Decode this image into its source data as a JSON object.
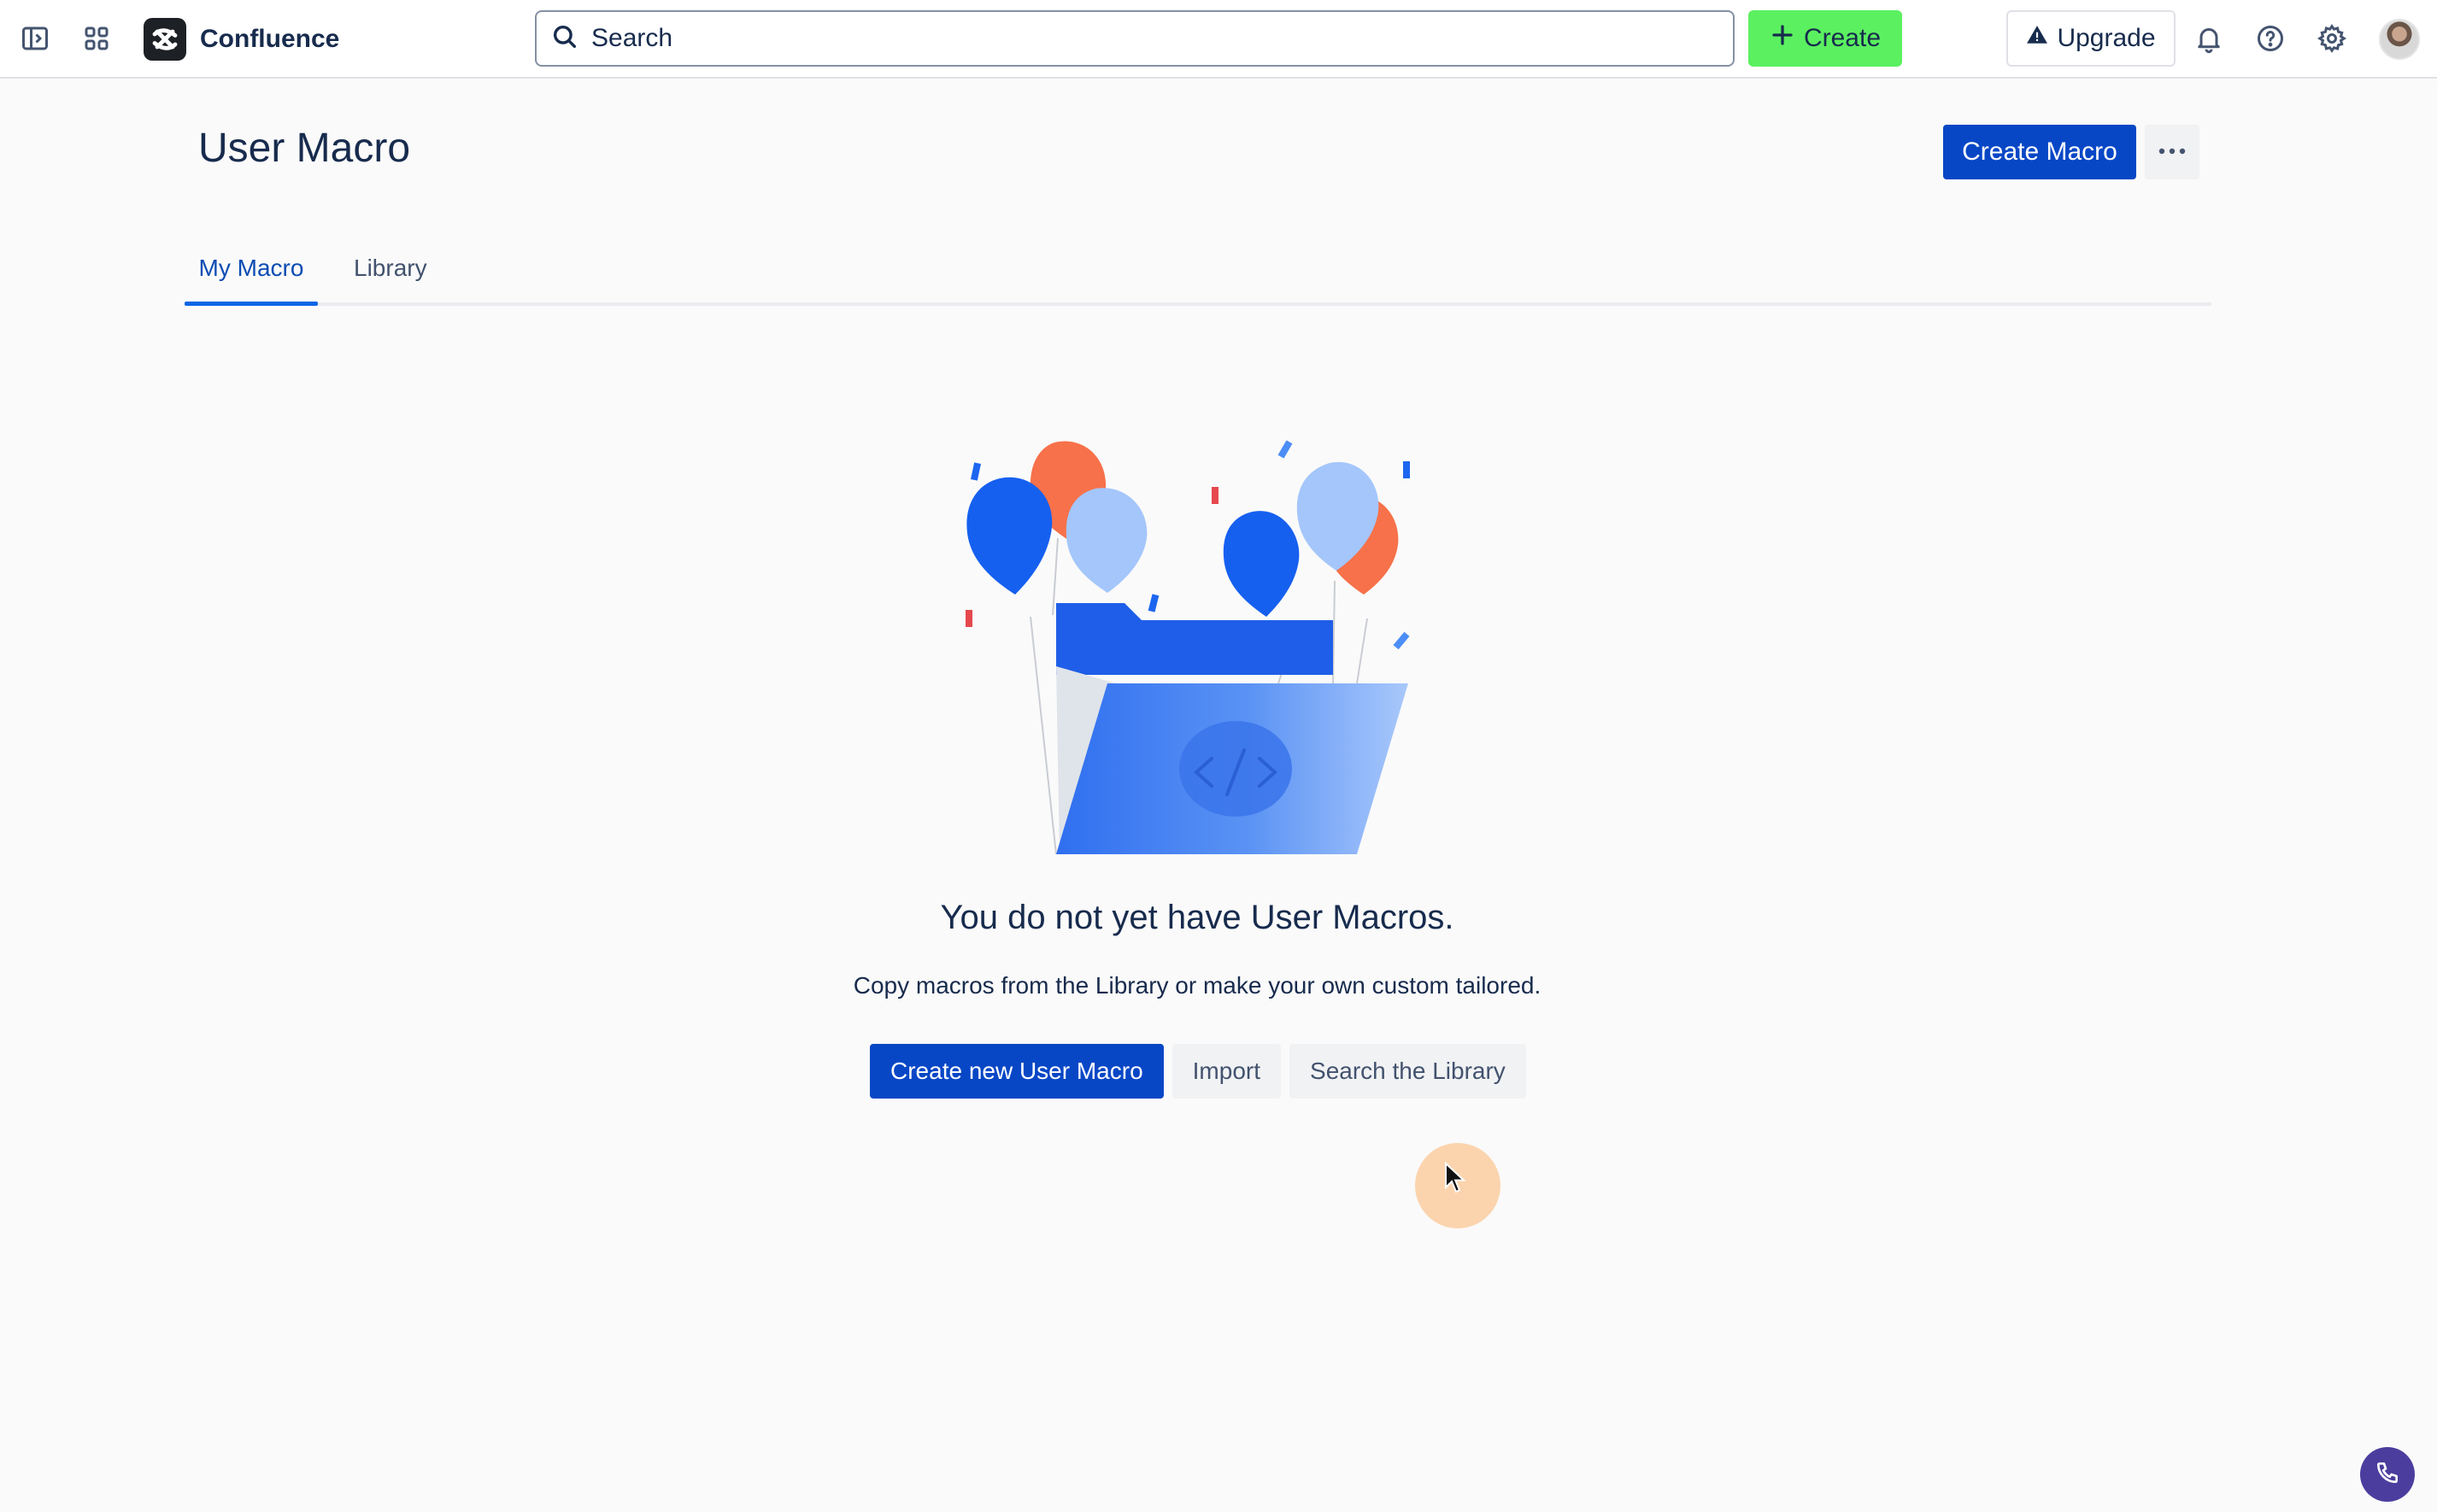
{
  "topbar": {
    "app_name": "Confluence",
    "search_placeholder": "Search",
    "create_label": "Create",
    "upgrade_label": "Upgrade",
    "icons": [
      "sidebar-toggle-icon",
      "app-switcher-icon",
      "confluence-logo-icon",
      "search-icon",
      "plus-icon",
      "warning-icon",
      "bell-icon",
      "help-icon",
      "gear-icon"
    ],
    "colors": {
      "create_bg": "#5bf060"
    }
  },
  "header": {
    "title": "User Macro",
    "create_macro_label": "Create Macro"
  },
  "tabs": [
    {
      "label": "My Macro",
      "active": true
    },
    {
      "label": "Library",
      "active": false
    }
  ],
  "empty_state": {
    "heading": "You do not yet have User Macros.",
    "description": "Copy macros from the Library or make your own custom tailored.",
    "actions": {
      "create_new": "Create new User Macro",
      "import": "Import",
      "search_library": "Search the Library"
    }
  },
  "colors": {
    "primary": "#0747c6",
    "tab_active": "#0c66e4",
    "balloon_blue": "#1660f0",
    "balloon_light": "#a4c6fb",
    "balloon_orange": "#f7714a"
  }
}
